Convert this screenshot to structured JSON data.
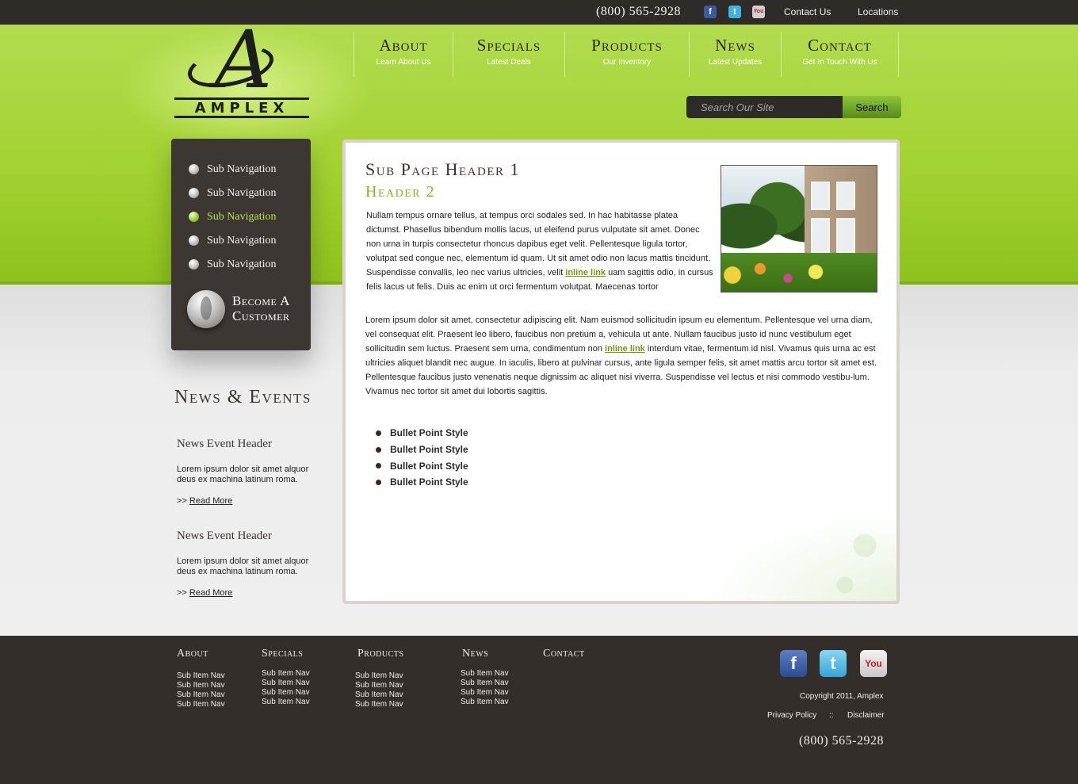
{
  "topbar": {
    "phone": "(800)  565-2928",
    "social": [
      "facebook-icon",
      "twitter-icon",
      "youtube-icon"
    ],
    "links": {
      "contact": "Contact Us",
      "locations": "Locations"
    }
  },
  "logo": {
    "letter": "A",
    "word": "AMPLEX"
  },
  "nav": [
    {
      "title": "About",
      "sub": "Learn About Us"
    },
    {
      "title": "Specials",
      "sub": "Latest Deals"
    },
    {
      "title": "Products",
      "sub": "Our Inventory"
    },
    {
      "title": "News",
      "sub": "Latest Updates"
    },
    {
      "title": "Contact",
      "sub": "Get In Touch With Us"
    }
  ],
  "search": {
    "placeholder": "Search Our Site",
    "button": "Search"
  },
  "subnav": {
    "items": [
      {
        "label": "Sub Navigation",
        "active": false
      },
      {
        "label": "Sub Navigation",
        "active": false
      },
      {
        "label": "Sub Navigation",
        "active": true
      },
      {
        "label": "Sub Navigation",
        "active": false
      },
      {
        "label": "Sub Navigation",
        "active": false
      }
    ],
    "cta": "Become A Customer"
  },
  "news": {
    "title": "News & Events",
    "items": [
      {
        "header": "News Event Header",
        "body": "Lorem ipsum dolor sit amet alquor deus ex machina latinum roma.",
        "more_prefix": ">> ",
        "more": "Read More"
      },
      {
        "header": "News Event Header",
        "body": "Lorem ipsum dolor sit amet alquor deus ex machina latinum roma.",
        "more_prefix": ">> ",
        "more": "Read More"
      }
    ]
  },
  "content": {
    "h1": "Sub Page Header 1",
    "h2": "Header 2",
    "para1_a": "Nullam tempus ornare tellus, at tempus orci sodales sed. In hac habitasse platea dictumst. Phasellus bibendum mollis lacus, ut eleifend purus vulputate sit amet. Donec non urna in turpis consectetur rhoncus dapibus eget velit. Pellentesque ligula tortor, volutpat sed congue nec, elementum id quam. Ut sit amet odio non lacus mattis tincidunt. Suspendisse convallis, leo nec varius ultricies, velit ",
    "para1_link": "inline link",
    "para1_b": " uam sagittis odio, in cursus felis lacus ut felis. Duis ac enim ut orci fermentum volutpat. Maecenas tortor",
    "para2_a": "Lorem ipsum dolor sit amet, consectetur adipiscing elit. Nam euismod sollicitudin ipsum eu elementum. Pellentesque vel urna diam, vel consequat elit. Praesent leo libero, faucibus non pretium a, vehicula ut ante. Nullam faucibus justo id nunc vestibulum eget sollicitudin sem luctus. Praesent sem urna, condimentum non ",
    "para2_link": "inline link",
    "para2_b": " interdum vitae, fermentum id nisl. Vivamus quis urna ac est ultricies aliquet blandit nec augue. In iaculis, libero at pulvinar cursus, ante ligula semper felis, sit amet mattis arcu tortor sit amet est. Pellentesque faucibus justo venenatis neque dignissim ac aliquet nisi viverra. Suspendisse vel lectus et nisi commodo vestibu-lum. Vivamus nec tortor sit amet dui lobortis sagittis.",
    "bullets": [
      "Bullet Point Style",
      "Bullet Point Style",
      "Bullet Point Style",
      "Bullet Point Style"
    ]
  },
  "footer": {
    "columns": [
      {
        "title": "About",
        "items": [
          "Sub Item Nav",
          "Sub Item Nav",
          "Sub Item Nav",
          "Sub Item Nav"
        ]
      },
      {
        "title": "Specials",
        "items": [
          "Sub Item Nav",
          "Sub Item Nav",
          "Sub Item Nav",
          "Sub Item Nav"
        ]
      },
      {
        "title": "Products",
        "items": [
          "Sub Item Nav",
          "Sub Item Nav",
          "Sub Item Nav",
          "Sub Item Nav"
        ]
      },
      {
        "title": "News",
        "items": [
          "Sub Item Nav",
          "Sub Item Nav",
          "Sub Item Nav",
          "Sub Item Nav"
        ]
      },
      {
        "title": "Contact",
        "items": []
      }
    ],
    "copyright": "Copyright 2011, Amplex",
    "privacy": "Privacy Policy",
    "separator": "::",
    "disclaimer": "Disclaimer",
    "phone": "(800)  565-2928"
  },
  "colors": {
    "green": "#a3d232",
    "dark": "#332e2a",
    "link_green": "#6f9a10",
    "header2_green": "#86b41f"
  }
}
